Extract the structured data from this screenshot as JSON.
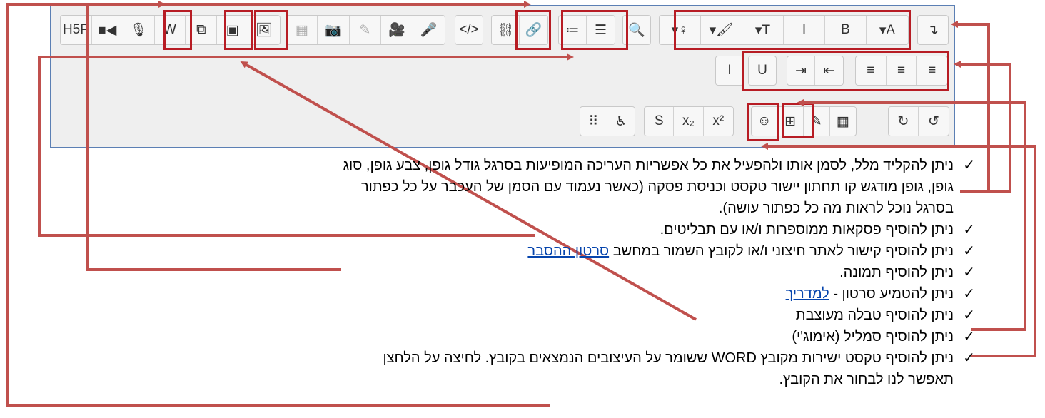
{
  "top_caption": "",
  "toolbar": {
    "row1": [
      {
        "name": "h5p-button",
        "label": "H5P",
        "icon": "h5p-icon",
        "dim": false
      },
      {
        "name": "video-button",
        "label": "■◀",
        "icon": "video-camera-icon",
        "dim": false
      },
      {
        "name": "microphone-button",
        "label": "🎙",
        "icon": "microphone-icon",
        "dim": false
      },
      {
        "name": "word-import-button",
        "label": "W",
        "icon": "word-icon",
        "dim": false
      },
      {
        "name": "copy-button",
        "label": "⧉",
        "icon": "copy-icon",
        "dim": false
      },
      {
        "name": "embed-video-button",
        "label": "▣",
        "icon": "file-video-icon",
        "dim": false
      },
      {
        "name": "image-button",
        "label": "🖼",
        "icon": "image-icon",
        "dim": false
      },
      {
        "name": "media-grid-button",
        "label": "▦",
        "icon": "grid-icon",
        "dim": true
      },
      {
        "name": "camera-button",
        "label": "📷",
        "icon": "camera-icon",
        "dim": true
      },
      {
        "name": "pencil-button",
        "label": "✎",
        "icon": "pencil-icon",
        "dim": true
      },
      {
        "name": "movie-button",
        "label": "🎥",
        "icon": "movie-camera-icon",
        "dim": true
      },
      {
        "name": "mic-disabled-button",
        "label": "🎤",
        "icon": "microphone-icon",
        "dim": true
      },
      {
        "name": "html-button",
        "label": "</>",
        "icon": "code-icon",
        "dim": false
      },
      {
        "name": "unlink-button",
        "label": "⛓",
        "icon": "unlink-icon",
        "dim": false
      },
      {
        "name": "link-button",
        "label": "🔗",
        "icon": "link-icon",
        "dim": false
      },
      {
        "name": "numbered-list-button",
        "label": "≔",
        "icon": "numbered-list-icon",
        "dim": false
      },
      {
        "name": "bullet-list-button",
        "label": "☰",
        "icon": "bullet-list-icon",
        "dim": false
      },
      {
        "name": "find-button",
        "label": "🔍",
        "icon": "search-icon",
        "dim": false
      },
      {
        "name": "highlight-button",
        "label": "▾♀",
        "icon": "highlighter-icon",
        "dim": false
      },
      {
        "name": "font-color-button",
        "label": "▾🖌",
        "icon": "paintbrush-icon",
        "dim": false
      },
      {
        "name": "font-size-button",
        "label": "▾T",
        "icon": "font-size-icon",
        "dim": false
      },
      {
        "name": "italic-button",
        "label": "I",
        "icon": "italic-icon",
        "dim": false
      },
      {
        "name": "bold-button",
        "label": "B",
        "icon": "bold-icon",
        "dim": false
      },
      {
        "name": "font-family-button",
        "label": "▾A",
        "icon": "font-family-icon",
        "dim": false
      },
      {
        "name": "rtl-button",
        "label": "↴",
        "icon": "text-direction-icon",
        "dim": false
      }
    ],
    "row2": [
      {
        "name": "cursor-button",
        "label": "I",
        "icon": "text-cursor-icon"
      },
      {
        "name": "underline-button",
        "label": "U",
        "icon": "underline-icon"
      },
      {
        "name": "indent-button",
        "label": "⇥",
        "icon": "indent-icon"
      },
      {
        "name": "outdent-button",
        "label": "⇤",
        "icon": "outdent-icon"
      },
      {
        "name": "align-right-button",
        "label": "≡",
        "icon": "align-right-icon"
      },
      {
        "name": "align-center-button",
        "label": "≡",
        "icon": "align-center-icon"
      },
      {
        "name": "align-left-button",
        "label": "≡",
        "icon": "align-left-icon"
      }
    ],
    "row3": [
      {
        "name": "braille-button",
        "label": "⠿",
        "icon": "braille-icon"
      },
      {
        "name": "accessibility-button",
        "label": "♿",
        "icon": "accessibility-icon"
      },
      {
        "name": "strikethrough-button",
        "label": "S",
        "icon": "strikethrough-icon"
      },
      {
        "name": "subscript-button",
        "label": "x₂",
        "icon": "subscript-icon"
      },
      {
        "name": "superscript-button",
        "label": "x²",
        "icon": "superscript-icon"
      },
      {
        "name": "emoji-button",
        "label": "☺",
        "icon": "smiley-icon"
      },
      {
        "name": "table-button",
        "label": "⊞",
        "icon": "table-icon"
      },
      {
        "name": "edit-button",
        "label": "✎",
        "icon": "edit-icon"
      },
      {
        "name": "calculator-button",
        "label": "▦",
        "icon": "calculator-icon"
      },
      {
        "name": "redo-button",
        "label": "↻",
        "icon": "redo-icon"
      },
      {
        "name": "undo-button",
        "label": "↺",
        "icon": "undo-icon"
      }
    ]
  },
  "notes": {
    "item1_line1": "ניתן להקליד מלל, לסמן אותו ולהפעיל את כל אפשריות העריכה המופיעות בסרגל גודל גופן, צבע גופן, סוג",
    "item1_line2": "גופן, גופן מודגש קו תחתון יישור טקסט וכניסת פסקה (כאשר נעמוד עם הסמן של העכבר על כל כפתור",
    "item1_line3": "בסרגל נוכל לראות מה כל כפתור עושה).",
    "item2": "ניתן להוסיף פסקאות ממוספרות ו/או עם תבליטים.",
    "item3_text": "ניתן להוסיף קישור לאתר חיצוני ו/או לקובץ השמור במחשב",
    "item3_link": "סרטון ההסבר",
    "item4": "ניתן להוסיף תמונה.",
    "item5_text": "ניתן להטמיע סרטון -",
    "item5_link": "למדריך",
    "item6": "ניתן להוסיף טבלה מעוצבת",
    "item7": "ניתן להוסיף סמליל (אימוג'י)",
    "item8_line1": "ניתן להוסיף טקסט ישירות מקובץ WORD ששומר על העיצובים הנמצאים בקובץ. לחיצה על הלחצן",
    "item8_line2": "תאפשר לנו לבחור את הקובץ.",
    "check": "✓"
  },
  "colors": {
    "highlight": "#b71c24",
    "arrow": "#c0504d",
    "link": "#0645ad",
    "editor_border": "#5b7fb4"
  }
}
